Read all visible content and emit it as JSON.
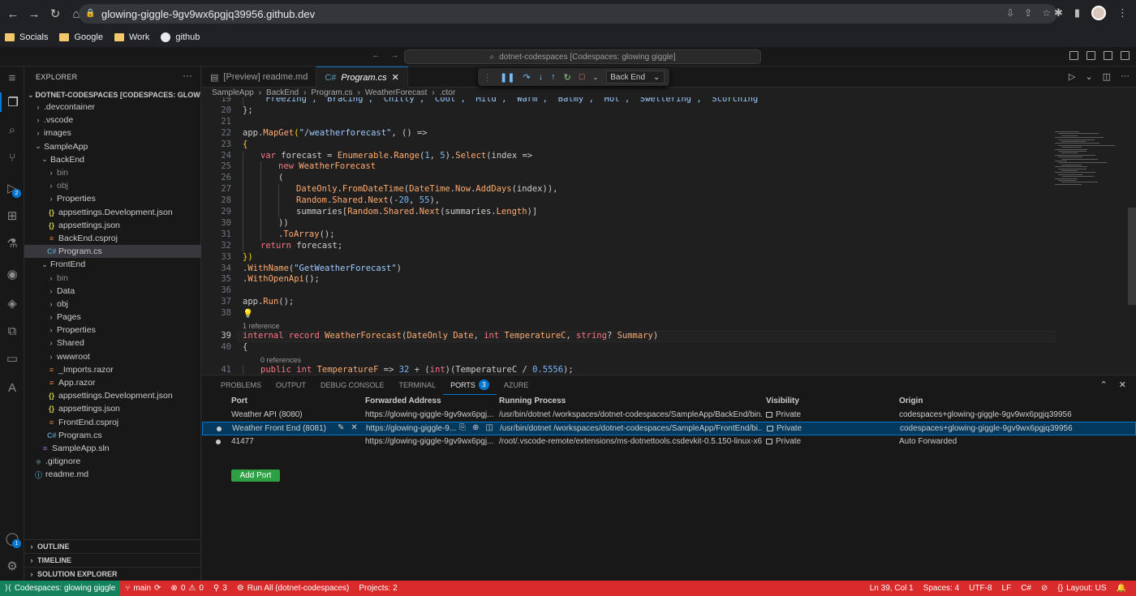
{
  "browser": {
    "url": "glowing-giggle-9gv9wx6pgjq39956.github.dev",
    "bookmarks": [
      "Socials",
      "Google",
      "Work",
      "github"
    ]
  },
  "titlebar": {
    "command_center": "dotnet-codespaces [Codespaces: glowing giggle]"
  },
  "activity": {
    "run_badge": "2",
    "accounts_badge": "1"
  },
  "explorer": {
    "title": "EXPLORER",
    "workspace": "DOTNET-CODESPACES [CODESPACES: GLOWING GI...",
    "items": [
      {
        "label": ".devcontainer",
        "depth": 1,
        "type": "folder"
      },
      {
        "label": ".vscode",
        "depth": 1,
        "type": "folder"
      },
      {
        "label": "images",
        "depth": 1,
        "type": "folder"
      },
      {
        "label": "SampleApp",
        "depth": 1,
        "type": "folder-open"
      },
      {
        "label": "BackEnd",
        "depth": 2,
        "type": "folder-open"
      },
      {
        "label": "bin",
        "depth": 3,
        "type": "folder",
        "dim": true
      },
      {
        "label": "obj",
        "depth": 3,
        "type": "folder",
        "dim": true
      },
      {
        "label": "Properties",
        "depth": 3,
        "type": "folder"
      },
      {
        "label": "appsettings.Development.json",
        "depth": 3,
        "type": "json"
      },
      {
        "label": "appsettings.json",
        "depth": 3,
        "type": "json"
      },
      {
        "label": "BackEnd.csproj",
        "depth": 3,
        "type": "proj"
      },
      {
        "label": "Program.cs",
        "depth": 3,
        "type": "cs",
        "selected": true
      },
      {
        "label": "FrontEnd",
        "depth": 2,
        "type": "folder-open"
      },
      {
        "label": "bin",
        "depth": 3,
        "type": "folder",
        "dim": true
      },
      {
        "label": "Data",
        "depth": 3,
        "type": "folder"
      },
      {
        "label": "obj",
        "depth": 3,
        "type": "folder"
      },
      {
        "label": "Pages",
        "depth": 3,
        "type": "folder"
      },
      {
        "label": "Properties",
        "depth": 3,
        "type": "folder"
      },
      {
        "label": "Shared",
        "depth": 3,
        "type": "folder"
      },
      {
        "label": "wwwroot",
        "depth": 3,
        "type": "folder"
      },
      {
        "label": "_Imports.razor",
        "depth": 3,
        "type": "razor"
      },
      {
        "label": "App.razor",
        "depth": 3,
        "type": "razor"
      },
      {
        "label": "appsettings.Development.json",
        "depth": 3,
        "type": "json"
      },
      {
        "label": "appsettings.json",
        "depth": 3,
        "type": "json"
      },
      {
        "label": "FrontEnd.csproj",
        "depth": 3,
        "type": "proj"
      },
      {
        "label": "Program.cs",
        "depth": 3,
        "type": "cs"
      },
      {
        "label": "SampleApp.sln",
        "depth": 2,
        "type": "sln"
      },
      {
        "label": ".gitignore",
        "depth": 1,
        "type": "git"
      },
      {
        "label": "readme.md",
        "depth": 1,
        "type": "info"
      }
    ],
    "sections": [
      "OUTLINE",
      "TIMELINE",
      "SOLUTION EXPLORER"
    ]
  },
  "editor": {
    "tabs": [
      {
        "label": "[Preview] readme.md",
        "active": false
      },
      {
        "label": "Program.cs",
        "active": true
      }
    ],
    "debug_config": "Back End",
    "breadcrumb": [
      "SampleApp",
      "BackEnd",
      "Program.cs",
      "WeatherForecast",
      ".ctor"
    ],
    "lines": [
      {
        "n": "19",
        "indent": 1,
        "tokens": [
          [
            "\"Freezing\", \"Bracing\", \"Chilly\", \"Cool\", \"Mild\", \"Warm\", \"Balmy\", \"Hot\", \"Sweltering\", \"Scorching\"",
            "st"
          ]
        ]
      },
      {
        "n": "20",
        "indent": 0,
        "tokens": [
          [
            "};",
            "pl"
          ]
        ]
      },
      {
        "n": "21",
        "indent": 0,
        "tokens": []
      },
      {
        "n": "22",
        "indent": 0,
        "tokens": [
          [
            "app",
            "pl"
          ],
          [
            ".",
            "pl"
          ],
          [
            "MapGet",
            "fn"
          ],
          [
            "(",
            "br"
          ],
          [
            "\"/weatherforecast\"",
            "st"
          ],
          [
            ", () =>",
            "pl"
          ]
        ]
      },
      {
        "n": "23",
        "indent": 0,
        "tokens": [
          [
            "{",
            "br"
          ]
        ]
      },
      {
        "n": "24",
        "indent": 1,
        "tokens": [
          [
            "var",
            "kw"
          ],
          [
            " forecast = ",
            "pl"
          ],
          [
            "Enumerable",
            "fn"
          ],
          [
            ".",
            "pl"
          ],
          [
            "Range",
            "fn"
          ],
          [
            "(",
            "pl"
          ],
          [
            "1",
            "nm"
          ],
          [
            ", ",
            "pl"
          ],
          [
            "5",
            "nm"
          ],
          [
            ").",
            "pl"
          ],
          [
            "Select",
            "fn"
          ],
          [
            "(index =>",
            "pl"
          ]
        ]
      },
      {
        "n": "25",
        "indent": 2,
        "tokens": [
          [
            "new",
            "kw"
          ],
          [
            " ",
            "pl"
          ],
          [
            "WeatherForecast",
            "fn"
          ]
        ]
      },
      {
        "n": "26",
        "indent": 2,
        "tokens": [
          [
            "(",
            "pl"
          ]
        ]
      },
      {
        "n": "27",
        "indent": 3,
        "tokens": [
          [
            "DateOnly",
            "fn"
          ],
          [
            ".",
            "pl"
          ],
          [
            "FromDateTime",
            "fn"
          ],
          [
            "(",
            "pl"
          ],
          [
            "DateTime",
            "fn"
          ],
          [
            ".",
            "pl"
          ],
          [
            "Now",
            "fn"
          ],
          [
            ".",
            "pl"
          ],
          [
            "AddDays",
            "fn"
          ],
          [
            "(index)),",
            "pl"
          ]
        ]
      },
      {
        "n": "28",
        "indent": 3,
        "tokens": [
          [
            "Random",
            "fn"
          ],
          [
            ".",
            "pl"
          ],
          [
            "Shared",
            "fn"
          ],
          [
            ".",
            "pl"
          ],
          [
            "Next",
            "fn"
          ],
          [
            "(-",
            "pl"
          ],
          [
            "20",
            "nm"
          ],
          [
            ", ",
            "pl"
          ],
          [
            "55",
            "nm"
          ],
          [
            "),",
            "pl"
          ]
        ]
      },
      {
        "n": "29",
        "indent": 3,
        "tokens": [
          [
            "summaries",
            "pl"
          ],
          [
            "[",
            "pl"
          ],
          [
            "Random",
            "fn"
          ],
          [
            ".",
            "pl"
          ],
          [
            "Shared",
            "fn"
          ],
          [
            ".",
            "pl"
          ],
          [
            "Next",
            "fn"
          ],
          [
            "(summaries.",
            "pl"
          ],
          [
            "Length",
            "fn"
          ],
          [
            ")]",
            "pl"
          ]
        ]
      },
      {
        "n": "30",
        "indent": 2,
        "tokens": [
          [
            "))",
            "pl"
          ]
        ]
      },
      {
        "n": "31",
        "indent": 2,
        "tokens": [
          [
            ".",
            "pl"
          ],
          [
            "ToArray",
            "fn"
          ],
          [
            "();",
            "pl"
          ]
        ]
      },
      {
        "n": "32",
        "indent": 1,
        "tokens": [
          [
            "return",
            "kw"
          ],
          [
            " forecast;",
            "pl"
          ]
        ]
      },
      {
        "n": "33",
        "indent": 0,
        "tokens": [
          [
            "})",
            "br"
          ]
        ]
      },
      {
        "n": "34",
        "indent": 0,
        "tokens": [
          [
            ".",
            "pl"
          ],
          [
            "WithName",
            "fn"
          ],
          [
            "(",
            "pl"
          ],
          [
            "\"GetWeatherForecast\"",
            "st"
          ],
          [
            ")",
            "pl"
          ]
        ]
      },
      {
        "n": "35",
        "indent": 0,
        "tokens": [
          [
            ".",
            "pl"
          ],
          [
            "WithOpenApi",
            "fn"
          ],
          [
            "();",
            "pl"
          ]
        ]
      },
      {
        "n": "36",
        "indent": 0,
        "tokens": []
      },
      {
        "n": "37",
        "indent": 0,
        "tokens": [
          [
            "app",
            "pl"
          ],
          [
            ".",
            "pl"
          ],
          [
            "Run",
            "fn"
          ],
          [
            "();",
            "pl"
          ]
        ]
      },
      {
        "n": "38",
        "indent": 0,
        "tokens": [
          [
            "💡",
            "br"
          ]
        ]
      },
      {
        "n": "",
        "hint": "1 reference"
      },
      {
        "n": "39",
        "indent": 0,
        "current": true,
        "tokens": [
          [
            "internal",
            "kw"
          ],
          [
            " ",
            "pl"
          ],
          [
            "record",
            "kw"
          ],
          [
            " ",
            "pl"
          ],
          [
            "WeatherForecast",
            "fn"
          ],
          [
            "(",
            "pl"
          ],
          [
            "DateOnly",
            "fn"
          ],
          [
            " ",
            "pl"
          ],
          [
            "Date",
            "fn"
          ],
          [
            ", ",
            "pl"
          ],
          [
            "int",
            "kw"
          ],
          [
            " ",
            "pl"
          ],
          [
            "TemperatureC",
            "fn"
          ],
          [
            ", ",
            "pl"
          ],
          [
            "string",
            "kw"
          ],
          [
            "? ",
            "pl"
          ],
          [
            "Summary",
            "fn"
          ],
          [
            ")",
            "pl"
          ]
        ]
      },
      {
        "n": "40",
        "indent": 0,
        "tokens": [
          [
            "{",
            "pl"
          ]
        ]
      },
      {
        "n": "",
        "hint": "0 references",
        "indent": 1
      },
      {
        "n": "41",
        "indent": 1,
        "tokens": [
          [
            "public",
            "kw"
          ],
          [
            " ",
            "pl"
          ],
          [
            "int",
            "kw"
          ],
          [
            " ",
            "pl"
          ],
          [
            "TemperatureF",
            "fn"
          ],
          [
            " => ",
            "pl"
          ],
          [
            "32",
            "nm"
          ],
          [
            " + (",
            "pl"
          ],
          [
            "int",
            "kw"
          ],
          [
            ")(TemperatureC / ",
            "pl"
          ],
          [
            "0.5556",
            "nm"
          ],
          [
            ");",
            "pl"
          ]
        ]
      }
    ]
  },
  "panel": {
    "tabs": [
      "PROBLEMS",
      "OUTPUT",
      "DEBUG CONSOLE",
      "TERMINAL",
      "PORTS",
      "AZURE"
    ],
    "ports_badge": "3",
    "headers": {
      "port": "Port",
      "address": "Forwarded Address",
      "process": "Running Process",
      "visibility": "Visibility",
      "origin": "Origin"
    },
    "rows": [
      {
        "port": "Weather API (8080)",
        "address": "https://glowing-giggle-9gv9wx6pgj...",
        "process": "/usr/bin/dotnet /workspaces/dotnet-codespaces/SampleApp/BackEnd/bin...",
        "visibility": "Private",
        "origin": "codespaces+glowing-giggle-9gv9wx6pgjq39956",
        "dot": false
      },
      {
        "port": "Weather Front End (8081)",
        "address": "https://glowing-giggle-9...",
        "process": "/usr/bin/dotnet /workspaces/dotnet-codespaces/SampleApp/FrontEnd/bi...",
        "visibility": "Private",
        "origin": "codespaces+glowing-giggle-9gv9wx6pgjq39956",
        "dot": true,
        "selected": true
      },
      {
        "port": "41477",
        "address": "https://glowing-giggle-9gv9wx6pgj...",
        "process": "/root/.vscode-remote/extensions/ms-dotnettools.csdevkit-0.5.150-linux-x6...",
        "visibility": "Private",
        "origin": "Auto Forwarded",
        "dot": true
      }
    ],
    "add_port": "Add Port"
  },
  "statusbar": {
    "remote": "Codespaces: glowing giggle",
    "branch": "main",
    "errors": "0",
    "warnings": "0",
    "ports": "3",
    "run": "Run All (dotnet-codespaces)",
    "projects": "Projects: 2",
    "position": "Ln 39, Col 1",
    "spaces": "Spaces: 4",
    "encoding": "UTF-8",
    "eol": "LF",
    "language": "C#",
    "layout": "Layout: US"
  }
}
